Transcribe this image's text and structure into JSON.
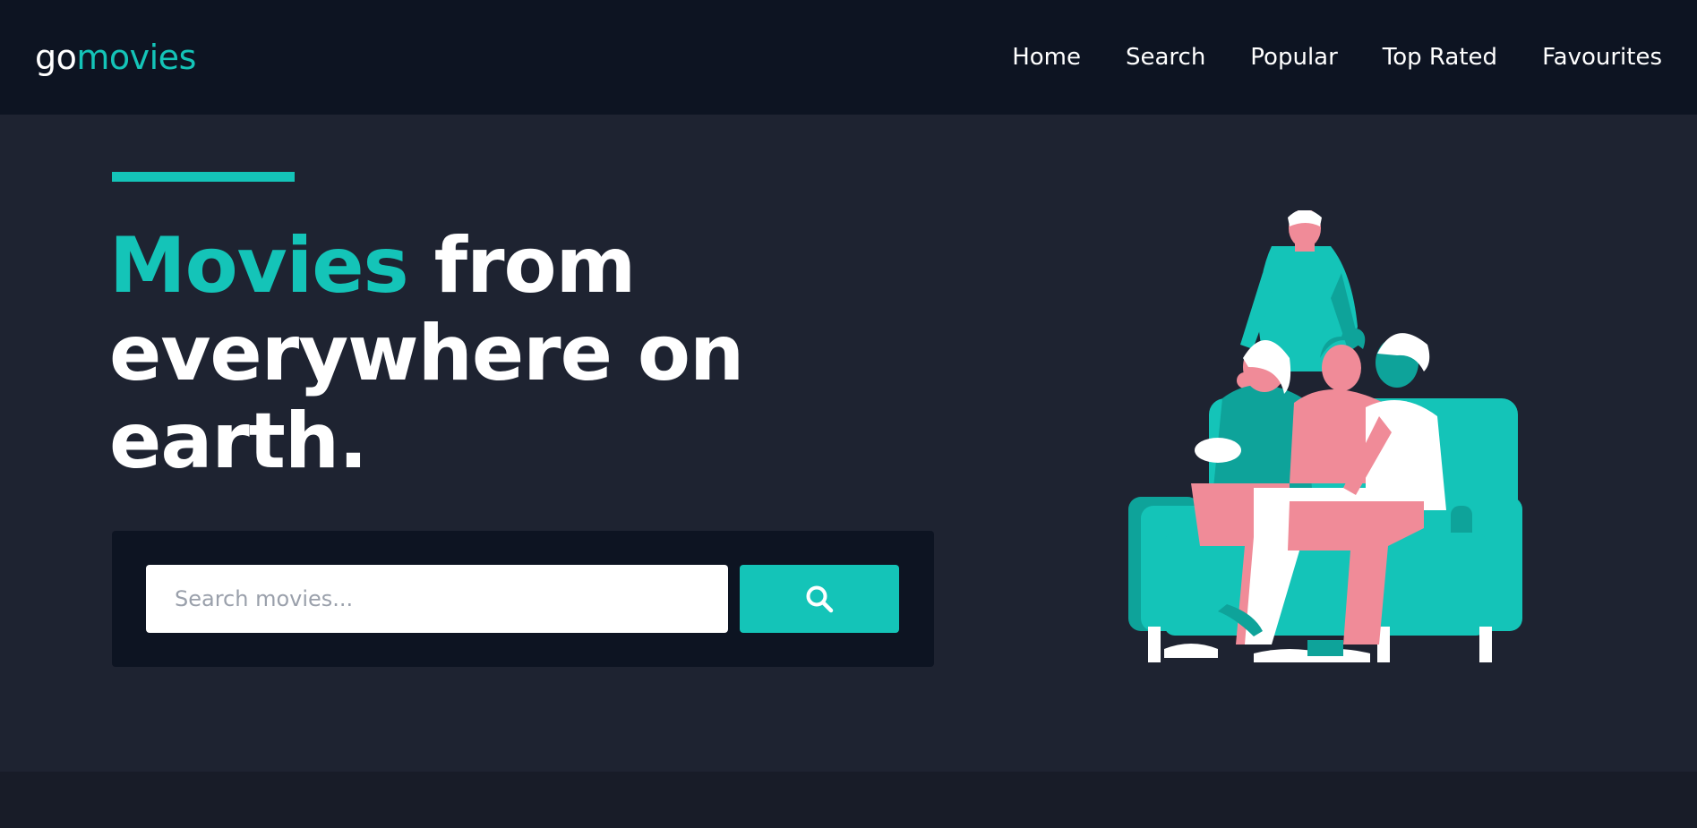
{
  "header": {
    "logo": {
      "prefix": "go",
      "accent": "movies"
    },
    "nav": [
      {
        "label": "Home"
      },
      {
        "label": "Search"
      },
      {
        "label": "Popular"
      },
      {
        "label": "Top Rated"
      },
      {
        "label": "Favourites"
      }
    ]
  },
  "hero": {
    "headline": {
      "accent": "Movies",
      "rest_line1": " from",
      "line2": "everywhere on",
      "line3": "earth."
    },
    "search": {
      "placeholder": "Search movies...",
      "button_icon": "search-icon"
    },
    "illustration": "family-watching-movie-on-couch"
  },
  "colors": {
    "accent": "#14c4b8",
    "navbar_bg": "#0d1422",
    "hero_bg": "#1e2331",
    "pink": "#f08b98",
    "white": "#ffffff"
  }
}
